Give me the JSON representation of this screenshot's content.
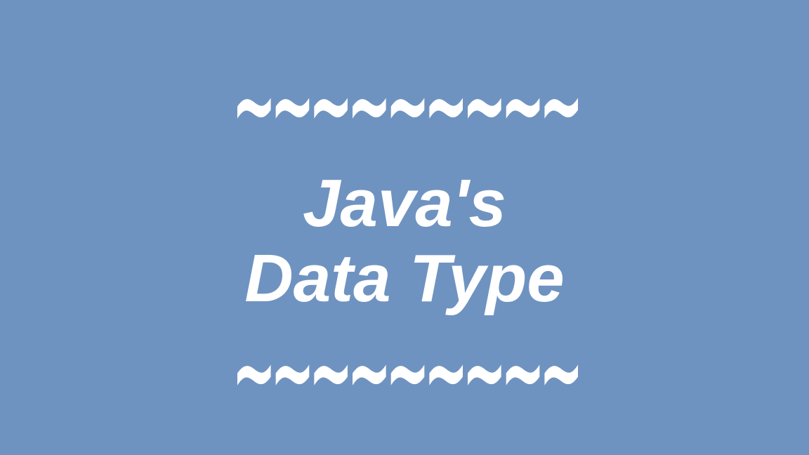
{
  "slide": {
    "background_color": "#6f93c0",
    "text_color": "#ffffff",
    "top_decoration": "~~~~~~~~~",
    "title_line1": "Java's",
    "title_line2": "Data Type",
    "bottom_decoration": "~~~~~~~~~"
  }
}
